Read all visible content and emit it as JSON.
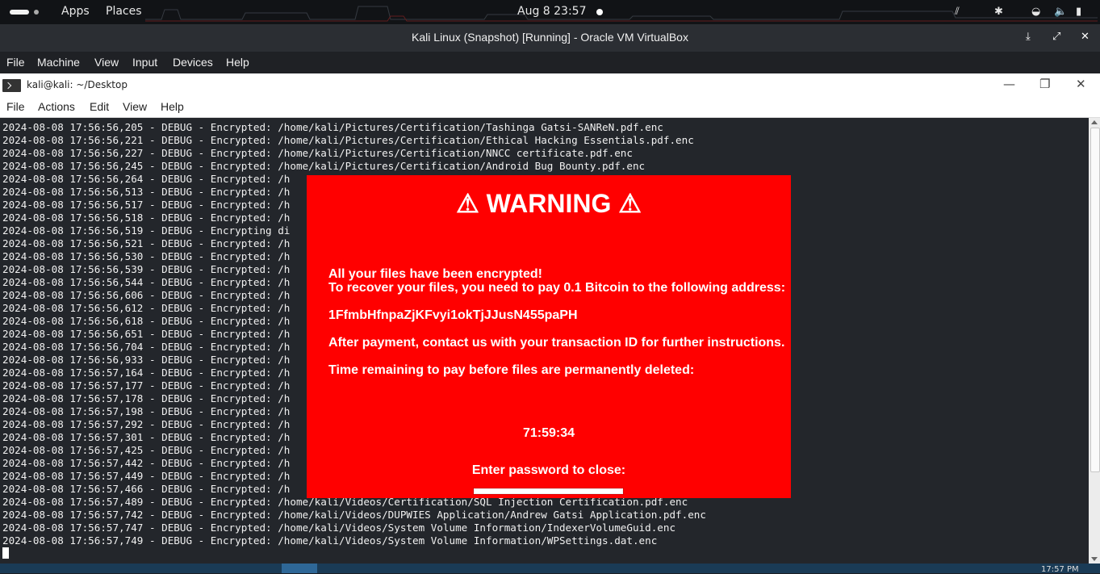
{
  "topbar": {
    "apps": "Apps",
    "places": "Places",
    "clock": "Aug 8  23:57"
  },
  "vbox": {
    "title": "Kali Linux (Snapshot) [Running] - Oracle VM VirtualBox",
    "menu": [
      "File",
      "Machine",
      "View",
      "Input",
      "Devices",
      "Help"
    ]
  },
  "terminal": {
    "title": "kali@kali: ~/Desktop",
    "menu": [
      "File",
      "Actions",
      "Edit",
      "View",
      "Help"
    ],
    "lines": [
      "2024-08-08 17:56:56,205 - DEBUG - Encrypted: /home/kali/Pictures/Certification/Tashinga Gatsi-SANReN.pdf.enc",
      "2024-08-08 17:56:56,221 - DEBUG - Encrypted: /home/kali/Pictures/Certification/Ethical Hacking Essentials.pdf.enc",
      "2024-08-08 17:56:56,227 - DEBUG - Encrypted: /home/kali/Pictures/Certification/NNCC certificate.pdf.enc",
      "2024-08-08 17:56:56,245 - DEBUG - Encrypted: /home/kali/Pictures/Certification/Android Bug Bounty.pdf.enc",
      "2024-08-08 17:56:56,264 - DEBUG - Encrypted: /h",
      "2024-08-08 17:56:56,513 - DEBUG - Encrypted: /h",
      "2024-08-08 17:56:56,517 - DEBUG - Encrypted: /h",
      "2024-08-08 17:56:56,518 - DEBUG - Encrypted: /h",
      "2024-08-08 17:56:56,519 - DEBUG - Encrypting di",
      "2024-08-08 17:56:56,521 - DEBUG - Encrypted: /h",
      "2024-08-08 17:56:56,530 - DEBUG - Encrypted: /h",
      "2024-08-08 17:56:56,539 - DEBUG - Encrypted: /h",
      "2024-08-08 17:56:56,544 - DEBUG - Encrypted: /h",
      "2024-08-08 17:56:56,606 - DEBUG - Encrypted: /h",
      "2024-08-08 17:56:56,612 - DEBUG - Encrypted: /h",
      "2024-08-08 17:56:56,618 - DEBUG - Encrypted: /h",
      "2024-08-08 17:56:56,651 - DEBUG - Encrypted: /h",
      "2024-08-08 17:56:56,704 - DEBUG - Encrypted: /h",
      "2024-08-08 17:56:56,933 - DEBUG - Encrypted: /h",
      "2024-08-08 17:56:57,164 - DEBUG - Encrypted: /h",
      "2024-08-08 17:56:57,177 - DEBUG - Encrypted: /h",
      "2024-08-08 17:56:57,178 - DEBUG - Encrypted: /h",
      "2024-08-08 17:56:57,198 - DEBUG - Encrypted: /h",
      "2024-08-08 17:56:57,292 - DEBUG - Encrypted: /h",
      "2024-08-08 17:56:57,301 - DEBUG - Encrypted: /h",
      "2024-08-08 17:56:57,425 - DEBUG - Encrypted: /h",
      "2024-08-08 17:56:57,442 - DEBUG - Encrypted: /h",
      "2024-08-08 17:56:57,449 - DEBUG - Encrypted: /h",
      "2024-08-08 17:56:57,466 - DEBUG - Encrypted: /h",
      "2024-08-08 17:56:57,489 - DEBUG - Encrypted: /home/kali/Videos/Certification/SQL Injection Certification.pdf.enc",
      "2024-08-08 17:56:57,742 - DEBUG - Encrypted: /home/kali/Videos/DUPWIES Application/Andrew Gatsi Application.pdf.enc",
      "2024-08-08 17:56:57,747 - DEBUG - Encrypted: /home/kali/Videos/System Volume Information/IndexerVolumeGuid.enc",
      "2024-08-08 17:56:57,749 - DEBUG - Encrypted: /home/kali/Videos/System Volume Information/WPSettings.dat.enc"
    ]
  },
  "ransom": {
    "title": "⚠ WARNING ⚠",
    "line1": "All your files have been encrypted!",
    "line2": "To recover your files, you need to pay 0.1 Bitcoin to the following address:",
    "address": "1FfmbHfnpaZjKFvyi1okTjJJusN455paPH",
    "line3": "After payment, contact us with your transaction ID for further instructions.",
    "line4": "Time remaining to pay before files are permanently deleted:",
    "timer": "71:59:34",
    "password_label": "Enter password to close:",
    "password_value": ""
  },
  "taskbar": {
    "clock": "17:57 PM"
  },
  "colors": {
    "ransom_bg": "#ff0000",
    "terminal_bg": "#23262b"
  },
  "icons": [
    "menu-pill-icon",
    "record-dot-icon",
    "network-speed-icon",
    "bluetooth-icon",
    "wifi-icon",
    "volume-icon",
    "battery-icon",
    "download-icon",
    "fullscreen-icon",
    "close-icon",
    "terminal-icon",
    "minimize-icon",
    "restore-icon"
  ]
}
